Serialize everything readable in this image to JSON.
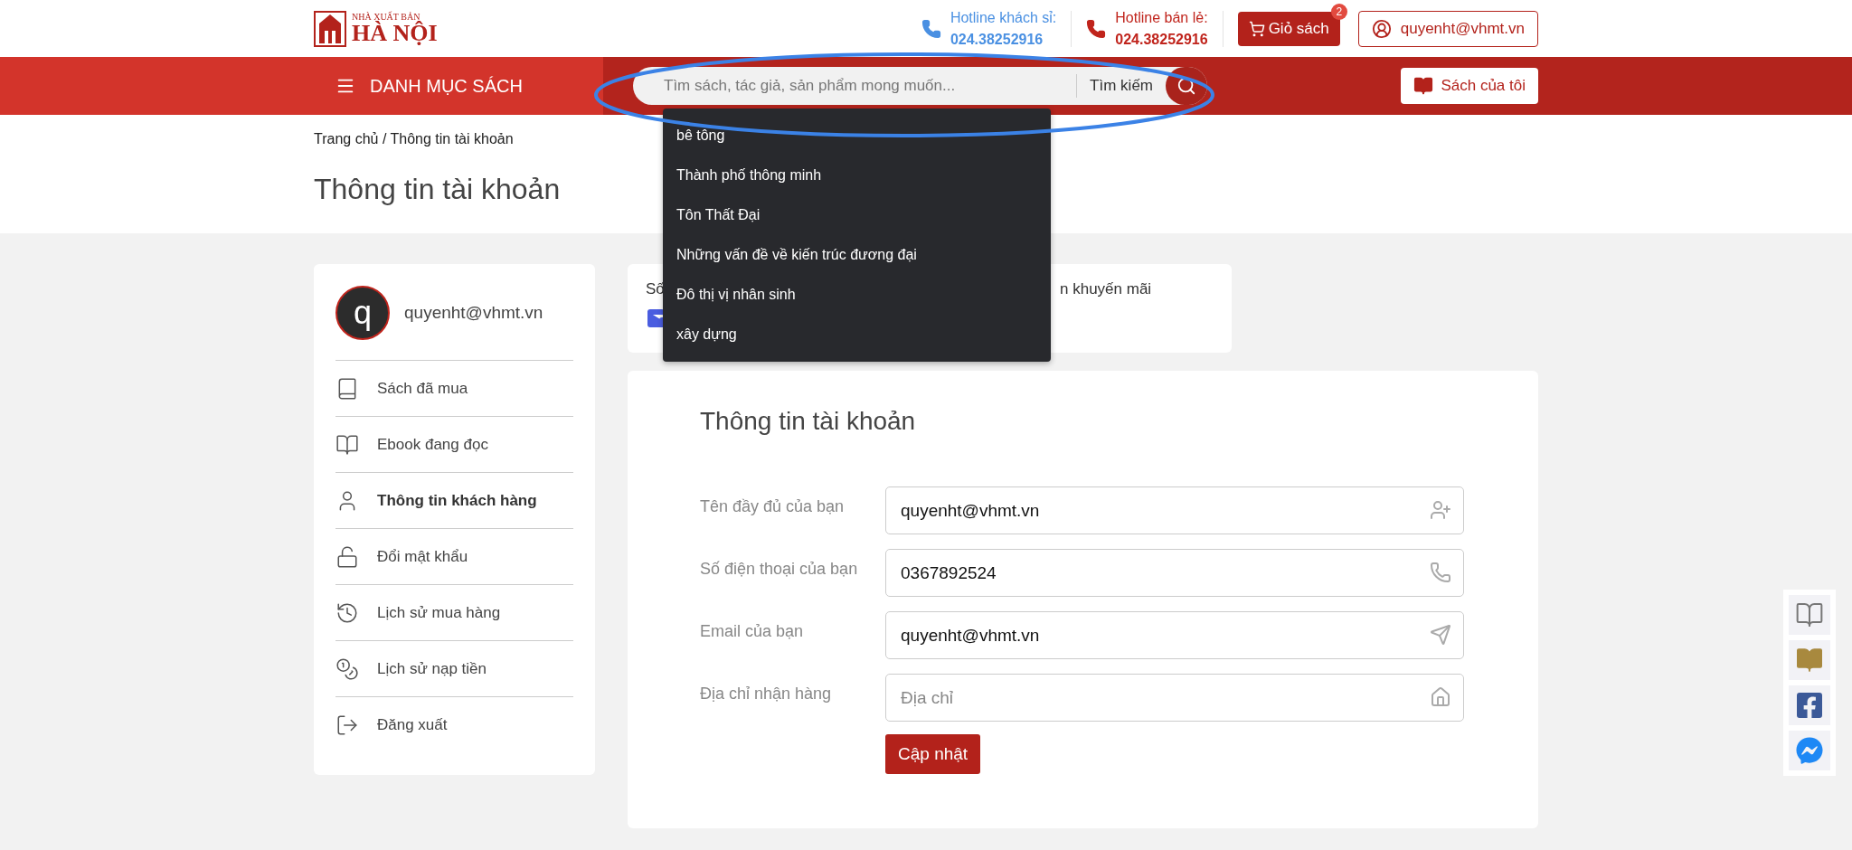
{
  "logo": {
    "line1": "NHÀ XUẤT BẢN",
    "line2": "HÀ NỘI"
  },
  "hotlines": [
    {
      "label": "Hotline khách sỉ:",
      "number": "024.38252916",
      "color": "#4a90e2"
    },
    {
      "label": "Hotline bán lẻ:",
      "number": "024.38252916",
      "color": "#c0241c"
    }
  ],
  "cart": {
    "label": "Giỏ sách",
    "badge": "2"
  },
  "account": {
    "label": "quyenht@vhmt.vn"
  },
  "nav": {
    "menu_label": "DANH MỤC SÁCH",
    "search": {
      "placeholder": "Tìm sách, tác giả, sản phẩm mong muốn...",
      "button": "Tìm kiếm"
    },
    "my_books": "Sách của tôi"
  },
  "search_suggestions": [
    "bê tông",
    "Thành phố thông minh",
    "Tôn Thất Đại",
    "Những vấn đề về kiến trúc đương đại",
    "Đô thị vị nhân sinh",
    "xây dựng"
  ],
  "breadcrumb": "Trang chủ / Thông tin tài khoản",
  "page_title": "Thông tin tài khoản",
  "profile": {
    "avatar_letter": "q",
    "email": "quyenht@vhmt.vn"
  },
  "sidebar": [
    {
      "label": "Sách đã mua",
      "kind": "book",
      "selected": false
    },
    {
      "label": "Ebook đang đọc",
      "kind": "ebook",
      "selected": false
    },
    {
      "label": "Thông tin khách hàng",
      "kind": "user",
      "selected": true
    },
    {
      "label": "Đổi mật khẩu",
      "kind": "lock",
      "selected": false
    },
    {
      "label": "Lịch sử mua hàng",
      "kind": "history",
      "selected": false
    },
    {
      "label": "Lịch sử nạp tiền",
      "kind": "topup",
      "selected": false
    },
    {
      "label": "Đăng xuất",
      "kind": "logout",
      "selected": false
    }
  ],
  "summary_card": {
    "text_left": "Số",
    "text_right": "n khuyến mãi"
  },
  "form": {
    "title": "Thông tin tài khoản",
    "fields": [
      {
        "label": "Tên đầy đủ của bạn",
        "value": "quyenht@vhmt.vn",
        "kind": "name"
      },
      {
        "label": "Số điện thoại của bạn",
        "value": "0367892524",
        "kind": "phone"
      },
      {
        "label": "Email của bạn",
        "value": "quyenht@vhmt.vn",
        "kind": "email"
      },
      {
        "label": "Địa chỉ nhận hàng",
        "placeholder": "Địa chỉ",
        "kind": "address"
      }
    ],
    "submit": "Cập nhật"
  }
}
